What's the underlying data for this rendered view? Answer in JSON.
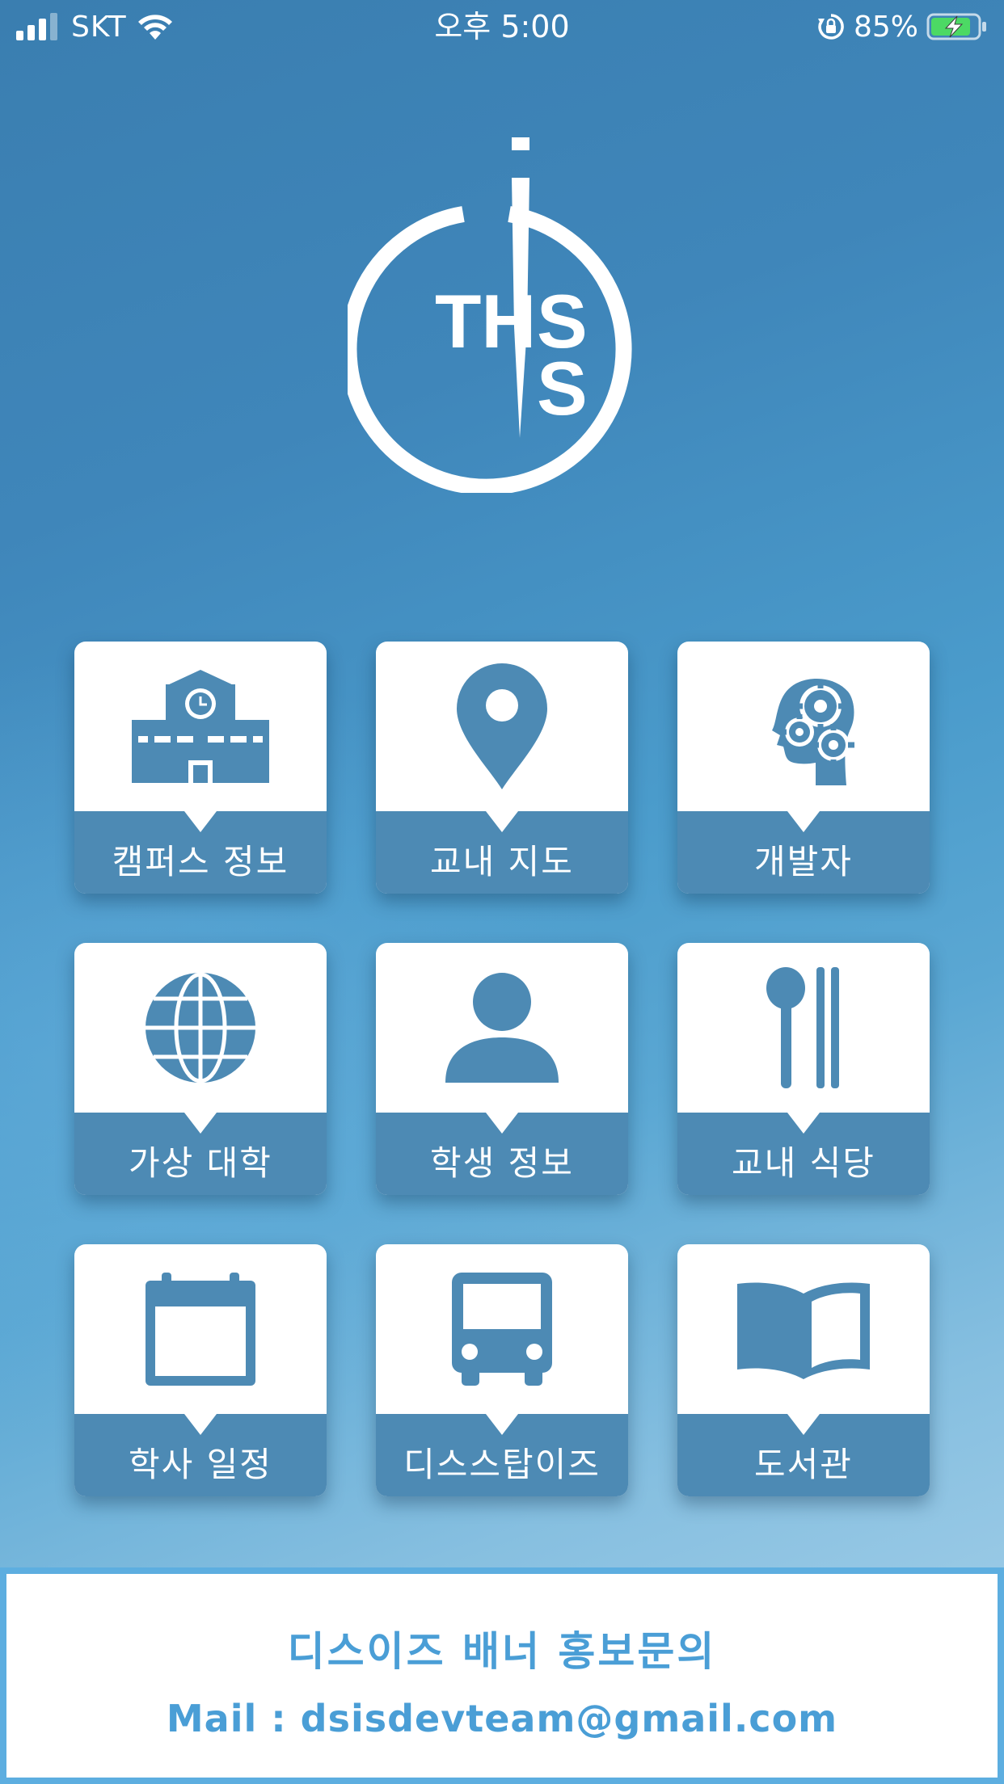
{
  "status_bar": {
    "carrier": "SKT",
    "time": "오후 5:00",
    "battery_percent": "85%",
    "icons": [
      "signal-icon",
      "wifi-icon",
      "orientation-lock-icon",
      "battery-charging-icon"
    ]
  },
  "logo": {
    "text_top": "TH",
    "text_right_1": "S",
    "text_right_2": "S"
  },
  "menu": {
    "items": [
      {
        "label": "캠퍼스 정보",
        "icon": "school-building-icon"
      },
      {
        "label": "교내 지도",
        "icon": "map-pin-icon"
      },
      {
        "label": "개발자",
        "icon": "head-gears-icon"
      },
      {
        "label": "가상 대학",
        "icon": "globe-icon"
      },
      {
        "label": "학생 정보",
        "icon": "person-icon"
      },
      {
        "label": "교내 식당",
        "icon": "spoon-chopsticks-icon"
      },
      {
        "label": "학사 일정",
        "icon": "calendar-icon"
      },
      {
        "label": "디스스탑이즈",
        "icon": "bus-icon"
      },
      {
        "label": "도서관",
        "icon": "book-icon"
      }
    ]
  },
  "banner": {
    "title": "디스이즈 배너 홍보문의",
    "mail": "Mail : dsisdevteam@gmail.com"
  },
  "colors": {
    "tile_band": "#4d8ab4",
    "icon": "#4d8ab4",
    "banner_text": "#4a9ed6",
    "banner_border": "#5daee0"
  }
}
